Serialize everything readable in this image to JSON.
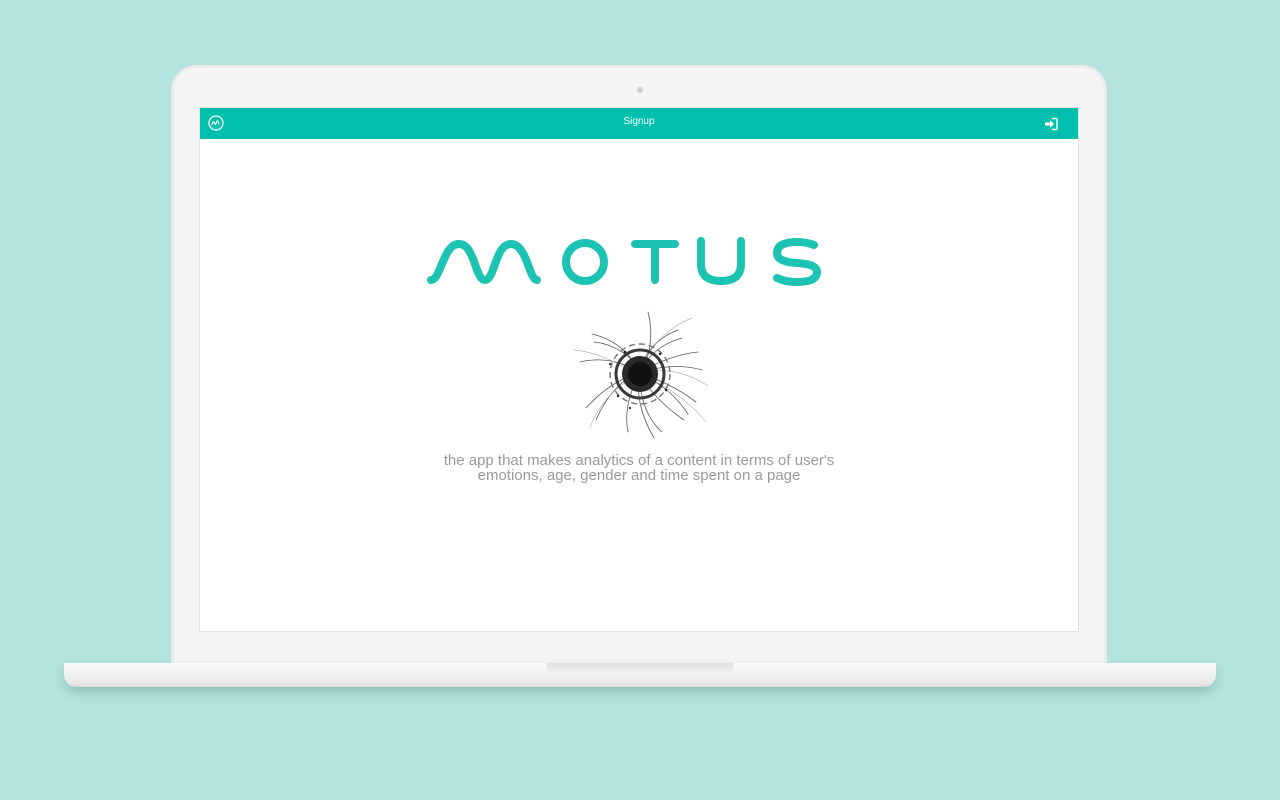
{
  "appbar": {
    "title": "Signup",
    "background": "#00bfad",
    "left_icon": "motus-logo-icon",
    "right_icon": "sign-in-icon"
  },
  "hero": {
    "wordmark": "MOTUS",
    "wordmark_color": "#1cc3b3",
    "tagline_line1": "the app that makes analytics of a content in terms of user's",
    "tagline_line2": "emotions, age, gender and time spent on a page"
  },
  "background_color": "#b5e3df"
}
